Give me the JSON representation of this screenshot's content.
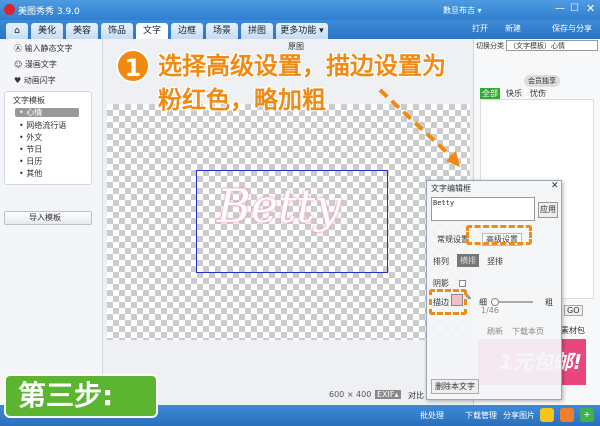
{
  "app": {
    "title": "美图秀秀 3.9.0",
    "user": "數旦布吉 ▾"
  },
  "tabs": [
    "美化",
    "美容",
    "饰品",
    "文字",
    "边框",
    "场景",
    "拼图",
    "更多功能 ▾"
  ],
  "top_actions": {
    "open": "打开",
    "new": "新建",
    "save": "保存与分享"
  },
  "left": {
    "items": [
      "输入静态文字",
      "漫画文字",
      "动画闪字"
    ],
    "template_title": "文字模板",
    "categories": [
      "心情",
      "网络流行语",
      "外文",
      "节日",
      "日历",
      "其他"
    ],
    "import": "导入模板"
  },
  "toolbar": {
    "original": "原图",
    "category_label": "切换分类",
    "category_value": "（文字模板）心情"
  },
  "right": {
    "filters": [
      "全部",
      "快乐",
      "忧伤"
    ],
    "member": "会员独享",
    "page": "1/46",
    "go": "GO",
    "refresh": "刷新",
    "download": "下载本页",
    "pack": "素材包",
    "promo": "1元包邮!"
  },
  "dialog": {
    "title": "文字编辑框",
    "text": "Betty",
    "apply": "应用",
    "tab_normal": "常规设置",
    "tab_advanced": "高级设置",
    "arrange": "排列",
    "horizontal": "横排",
    "vertical": "竖排",
    "shadow": "阴影",
    "stroke": "描边",
    "thin": "细",
    "thick": "粗",
    "delete": "删除本文字",
    "stroke_color": "#f4c0c8",
    "stroke_width": 0.1
  },
  "canvas": {
    "text": "Betty",
    "size": "600 × 400",
    "exif": "EXIF▴",
    "compare": "对比"
  },
  "status": {
    "batch": "批处理",
    "download": "下载管理",
    "share": "分享图片"
  },
  "annotation": {
    "num": "1",
    "line1": "选择高级设置，描边设置为",
    "line2": "粉红色，略加粗",
    "step": "第三步:"
  }
}
